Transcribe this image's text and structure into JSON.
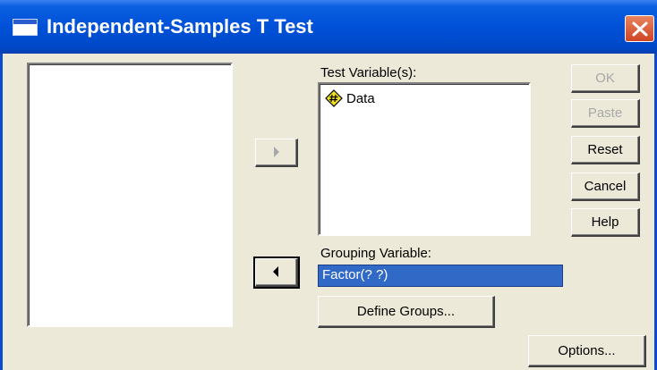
{
  "window": {
    "title": "Independent-Samples T Test"
  },
  "test_variables": {
    "label": "Test Variable(s):",
    "items": [
      "Data"
    ]
  },
  "grouping_variable": {
    "label": "Grouping Variable:",
    "value": "Factor(? ?)"
  },
  "buttons": {
    "ok": "OK",
    "paste": "Paste",
    "reset": "Reset",
    "cancel": "Cancel",
    "help": "Help",
    "define_groups": "Define Groups...",
    "options": "Options..."
  },
  "colors": {
    "titlebar": "#0051d8",
    "dialog_bg": "#ece9d8",
    "selection": "#3169c6",
    "close": "#cf4525"
  }
}
